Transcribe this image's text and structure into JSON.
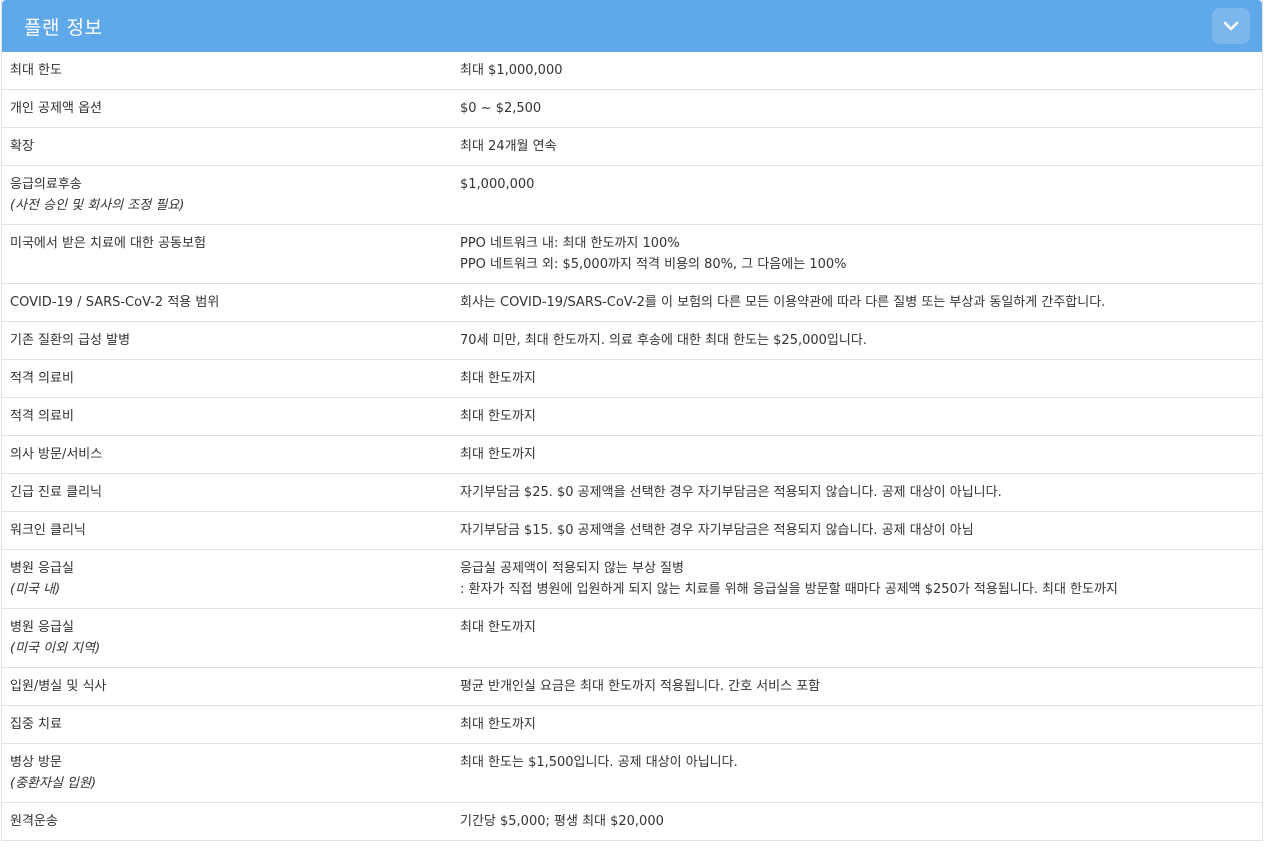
{
  "header": {
    "title": "플랜 정보",
    "toggle_icon": "chevron-down-icon"
  },
  "rows": [
    {
      "label": "최대 한도",
      "sub": "",
      "value": [
        "최대 $1,000,000"
      ]
    },
    {
      "label": "개인 공제액 옵션",
      "sub": "",
      "value": [
        "$0 ~ $2,500"
      ]
    },
    {
      "label": "확장",
      "sub": "",
      "value": [
        "최대 24개월 연속"
      ]
    },
    {
      "label": "응급의료후송",
      "sub": "(사전 승인 및 회사의 조정 필요)",
      "value": [
        "$1,000,000"
      ]
    },
    {
      "label": "미국에서 받은 치료에 대한 공동보험",
      "sub": "",
      "value": [
        "PPO 네트워크 내: 최대 한도까지 100%",
        "PPO 네트워크 외: $5,000까지 적격 비용의 80%, 그 다음에는 100%"
      ]
    },
    {
      "label": "COVID-19 / SARS-CoV-2 적용 범위",
      "sub": "",
      "value": [
        "회사는 COVID-19/SARS-CoV-2를 이 보험의 다른 모든 이용약관에 따라 다른 질병 또는 부상과 동일하게 간주합니다."
      ]
    },
    {
      "label": "기존 질환의 급성 발병",
      "sub": "",
      "value": [
        "70세 미만, 최대 한도까지. 의료 후송에 대한 최대 한도는 $25,000입니다."
      ]
    },
    {
      "label": "적격 의료비",
      "sub": "",
      "value": [
        "최대 한도까지"
      ]
    },
    {
      "label": "적격 의료비",
      "sub": "",
      "value": [
        "최대 한도까지"
      ]
    },
    {
      "label": "의사 방문/서비스",
      "sub": "",
      "value": [
        "최대 한도까지"
      ]
    },
    {
      "label": "긴급 진료 클리닉",
      "sub": "",
      "value": [
        "자기부담금 $25. $0 공제액을 선택한 경우 자기부담금은 적용되지 않습니다. 공제 대상이 아닙니다."
      ]
    },
    {
      "label": "워크인 클리닉",
      "sub": "",
      "value": [
        "자기부담금 $15. $0 공제액을 선택한 경우 자기부담금은 적용되지 않습니다. 공제 대상이 아님"
      ]
    },
    {
      "label": "병원 응급실",
      "sub": "(미국 내)",
      "value": [
        "응급실 공제액이 적용되지 않는 부상 질병",
        ": 환자가 직접 병원에 입원하게 되지 않는 치료를 위해 응급실을 방문할 때마다 공제액 $250가 적용됩니다. 최대 한도까지"
      ]
    },
    {
      "label": "병원 응급실",
      "sub": "(미국 이외 지역)",
      "value": [
        "최대 한도까지"
      ]
    },
    {
      "label": "입원/병실 및 식사",
      "sub": "",
      "value": [
        "평균 반개인실 요금은 최대 한도까지 적용됩니다. 간호 서비스 포함"
      ]
    },
    {
      "label": "집중 치료",
      "sub": "",
      "value": [
        "최대 한도까지"
      ]
    },
    {
      "label": "병상 방문",
      "sub": "(중환자실 입원)",
      "value": [
        "최대 한도는 $1,500입니다. 공제 대상이 아닙니다."
      ]
    },
    {
      "label": "원격운송",
      "sub": "",
      "value": [
        "기간당 $5,000; 평생 최대 $20,000"
      ]
    }
  ]
}
